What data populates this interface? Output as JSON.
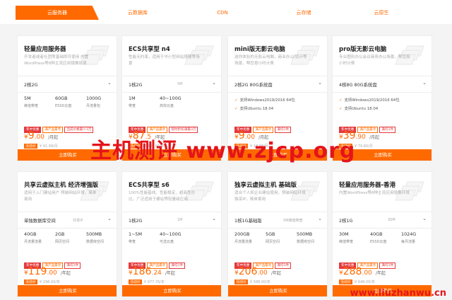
{
  "tabs": [
    "云服务器",
    "云数据库",
    "CDN",
    "云存储",
    "云原生"
  ],
  "colors": {
    "accent": "#ff6a00",
    "watermark": "#e4141b"
  },
  "cards": [
    {
      "title": "轻量应用服务器",
      "desc": "开发者或者社团零基础即可使用 内置WordPress等8种主流应用镜像环境",
      "select": "2核2G",
      "hint": "",
      "specs": [
        {
          "v": "5M",
          "l": "峰值带宽"
        },
        {
          "v": "60GB",
          "l": "ESSD云盘"
        },
        {
          "v": "1000G",
          "l": "月流量包"
        }
      ],
      "tags": [
        "年中优惠",
        "满产品最专",
        "当前价格最少3万"
      ],
      "price_cur": "¥",
      "price": "9",
      "price_dec": ".00",
      "price_unit": "/月起",
      "orig_badge": "活动价",
      "orig": "¥ 91.99/月",
      "buy": "立即购买"
    },
    {
      "title": "ECS共享型 n4",
      "desc": "性能无约束，适用于中小型网站搭建等场景",
      "select": "1核2G",
      "hint": "5M",
      "specs": [
        {
          "v": "1M",
          "l": "带宽"
        },
        {
          "v": "40~100G",
          "l": "高效云盘"
        }
      ],
      "tags": [
        "年中优惠",
        "满产品最享",
        "限时折扣满最3万"
      ],
      "price_cur": "¥",
      "price": "87",
      "price_dec": ".5",
      "price_unit": "/年起",
      "orig_badge": "活动价",
      "orig": "¥ 285.00/年",
      "buy": "立即购买"
    },
    {
      "title": "mini版无影云电脑",
      "desc": "送你体验的无影云电脑，商业办公/设计等场景，帮您按小时计费",
      "select": "2核2G 80G系统盘",
      "hint": "",
      "feats": [
        "支持Windows2019/2016 64位",
        "支持Ubuntu 18.04"
      ],
      "tags": [
        "年中优惠",
        "满产品最享",
        "满均1件"
      ],
      "price_cur": "¥",
      "price": "9",
      "price_dec": ".00",
      "price_unit": "/月起",
      "orig_badge": "活动价",
      "orig": "¥ 18.98/月",
      "buy": "立即购买"
    },
    {
      "title": "pro版无影云电脑",
      "desc": "专业图形办公会议商务办公场景，帮您按小时计费",
      "select": "4核8G 80G系统盘",
      "hint": "",
      "feats": [
        "支持Windows2019/2016 64位",
        "支持Ubuntu 18.04"
      ],
      "tags": [
        "年中优惠",
        "满产品最享",
        "满均1件"
      ],
      "price_cur": "¥",
      "price": "39",
      "price_dec": ".90",
      "price_unit": "/月起",
      "orig_badge": "活动价",
      "orig": "¥ 79.80/月",
      "buy": "立即购买"
    },
    {
      "title": "共享云虚拟主机 经济增强版",
      "desc": "适用于入门建站用户 预装网站环境，简单易用",
      "select": "单独数据库空间",
      "hint": "共享IP",
      "specs": [
        {
          "v": "40GB",
          "l": "月流量流量"
        },
        {
          "v": "2GB",
          "l": "网页空间"
        },
        {
          "v": "500MB",
          "l": "数据库空间"
        }
      ],
      "tags": [
        "年中优惠",
        "满产品最享",
        "满均1件"
      ],
      "price_cur": "¥",
      "price": "119",
      "price_dec": ".00",
      "price_unit": "/年起",
      "orig_badge": "活动价",
      "orig": "¥ 298.00/年",
      "buy": "立即购买"
    },
    {
      "title": "ECS共享型 s6",
      "desc": "100%性能基线，性能稳定，超高性价比，广泛适用于建站等轻量级应用",
      "select": "1核2G",
      "hint": "1M",
      "specs": [
        {
          "v": "1~5M",
          "l": "带宽"
        },
        {
          "v": "40~100G",
          "l": "可选云盘"
        }
      ],
      "tags": [
        "年中优惠",
        "满产品最享",
        "满均1件"
      ],
      "price_cur": "¥",
      "price": "186",
      "price_dec": ".24",
      "price_unit": "/年起",
      "orig_badge": "活动价",
      "orig": "¥ 977.76/年",
      "buy": "立即购买"
    },
    {
      "title": "独享云虚拟主机 基础版",
      "desc": "适合个人和企业建站使用，预装网站环境独享IP，简单易用",
      "select": "1核1G基础版",
      "hint": "5M峰值带宽",
      "specs": [
        {
          "v": "200GB",
          "l": "月流量流量"
        },
        {
          "v": "5GB",
          "l": "网页空间"
        },
        {
          "v": "500MB",
          "l": "数据库空间"
        }
      ],
      "tags": [
        "年中优惠",
        "满产品最享",
        "满均1件"
      ],
      "price_cur": "¥",
      "price": "206",
      "price_dec": ".00",
      "price_unit": "/年起",
      "orig_badge": "活动价",
      "orig": "¥ 588.00/年",
      "buy": "立即购买"
    },
    {
      "title": "轻量应用服务器-香港",
      "desc": "内置WordPress等8种主流应用镜像环境",
      "select": "2核1G",
      "hint": "30M",
      "specs": [
        {
          "v": "30M",
          "l": "峰值带宽"
        },
        {
          "v": "40GB",
          "l": "ESSD云盘"
        },
        {
          "v": "1024G",
          "l": "每月流量"
        }
      ],
      "tags": [
        "年中优惠",
        "满产品最享",
        "满均1件"
      ],
      "price_cur": "¥",
      "price": "288",
      "price_dec": ".00",
      "price_unit": "/年起",
      "orig_badge": "活动价",
      "orig": "¥ 648.00/年",
      "buy": "立即购买"
    }
  ],
  "watermark": "主机测评 www.zjcp.org",
  "watermark2": "www.liuzhanwu.cn"
}
